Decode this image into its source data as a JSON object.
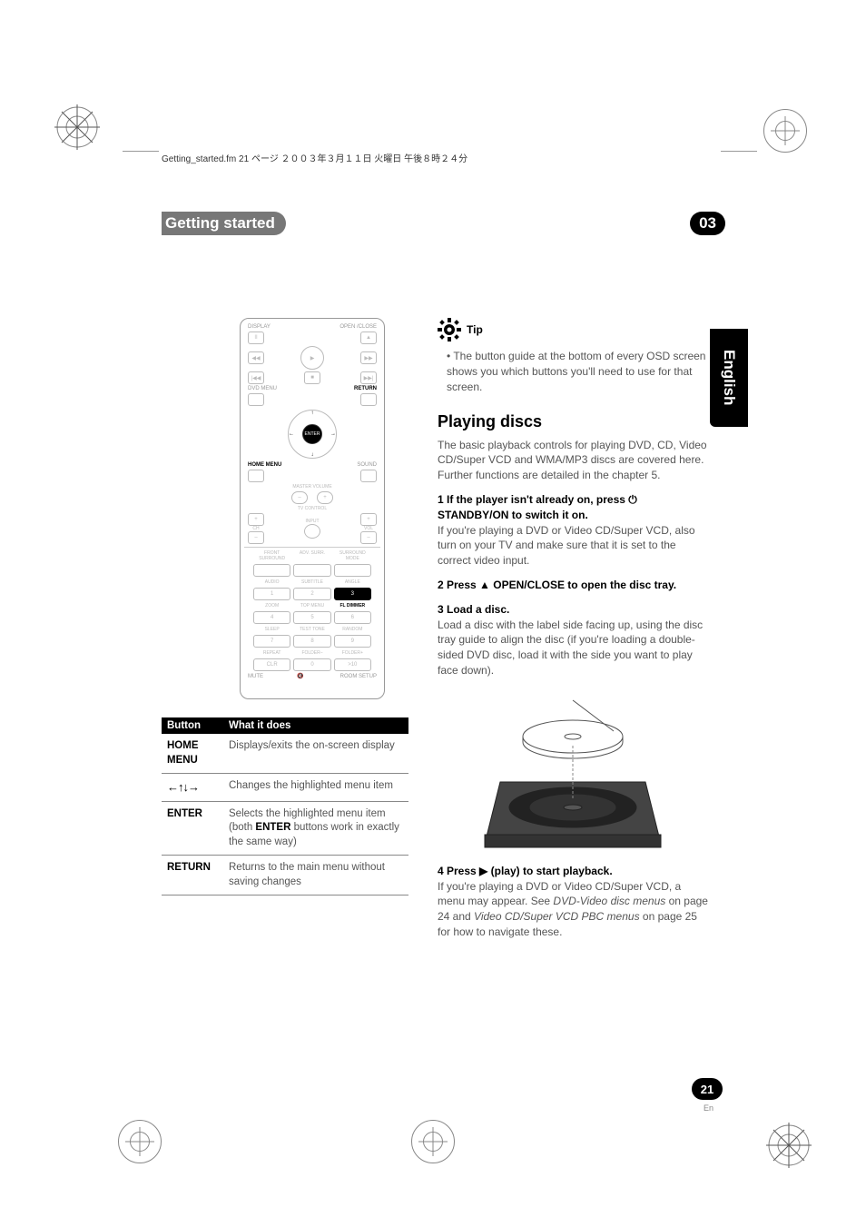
{
  "header_line": "Getting_started.fm 21 ページ ２００３年３月１１日 火曜日 午後８時２４分",
  "chapter": {
    "title": "Getting started",
    "number": "03"
  },
  "lang_tab": "English",
  "remote": {
    "top_left": "DISPLAY",
    "top_right": "OPEN /CLOSE",
    "row2_left": "◀◀",
    "row2_right": "▶▶",
    "row3_left": "|◀◀",
    "row3_mid": "■",
    "row3_right": "▶▶|",
    "dvd_menu": "DVD MENU",
    "return": "RETURN",
    "enter": "ENTER",
    "home_menu": "HOME MENU",
    "sound": "SOUND",
    "master_vol": "MASTER VOLUME",
    "tv_control": "TV CONTROL",
    "ch": "CH",
    "input": "INPUT",
    "vol": "VOL",
    "abc": "FRONT SURROUND",
    "abcd": "ADV. SURR.",
    "abce": "SURROUND MODE",
    "audio": "AUDIO",
    "subtitle": "SUBTITLE",
    "angle": "ANGLE",
    "zoom": "ZOOM",
    "top_menu": "TOP MENU",
    "fl_dim": "FL DIMMER",
    "sleep": "SLEEP",
    "test_tone": "TEST TONE",
    "random": "RANDOM",
    "repeat": "REPEAT",
    "clr": "CLR",
    "folder_m": "FOLDER–",
    "folder_p": "FOLDER+",
    "mute": "MUTE",
    "room_setup": "ROOM SETUP",
    "num1": "1",
    "num2": "2",
    "num3": "3",
    "num4": "4",
    "num5": "5",
    "num6": "6",
    "num7": "7",
    "num8": "8",
    "num9": "9",
    "num0": "0",
    "num10": ">10"
  },
  "table": {
    "h1": "Button",
    "h2": "What it does",
    "rows": [
      {
        "key": "HOME MENU",
        "desc": "Displays/exits the on-screen display"
      },
      {
        "key_arrows": "←↑↓→",
        "desc": "Changes the highlighted menu item"
      },
      {
        "key": "ENTER",
        "desc_a": "Selects the highlighted menu item (both ",
        "desc_b": "ENTER",
        "desc_c": " buttons work in exactly the same way)"
      },
      {
        "key": "RETURN",
        "desc": "Returns to the main menu without saving changes"
      }
    ]
  },
  "tip": {
    "label": "Tip",
    "bullet": "The button guide at the bottom of every OSD screen shows you which buttons you'll need to use for that screen."
  },
  "playing": {
    "heading": "Playing discs",
    "intro": "The basic playback controls for playing DVD, CD, Video CD/Super VCD and WMA/MP3 discs are covered here. Further functions are detailed in the chapter 5.",
    "s1a": "1   If the player isn't already on, press ",
    "s1b": " STANDBY/ON to switch it on.",
    "s1_body": "If you're playing a DVD or Video CD/Super VCD, also turn on your TV and make sure that it is set to the correct video input.",
    "s2a": "2   Press ",
    "s2b": " OPEN/CLOSE to open the disc tray.",
    "s3": "3   Load a disc.",
    "s3_body": "Load a disc with the label side facing up, using the disc tray guide to align the disc (if you're loading a double-sided DVD disc, load it with the side you want to play face down).",
    "s4a": "4   Press ",
    "s4b": " (play) to start playback.",
    "s4_body_a": "If you're playing a DVD or Video CD/Super VCD, a menu may appear. See ",
    "s4_body_b": "DVD-Video disc menus",
    "s4_body_c": " on page 24 and ",
    "s4_body_d": "Video CD/Super VCD PBC menus",
    "s4_body_e": " on page 25 for how to navigate these."
  },
  "page": {
    "num": "21",
    "lang": "En"
  }
}
